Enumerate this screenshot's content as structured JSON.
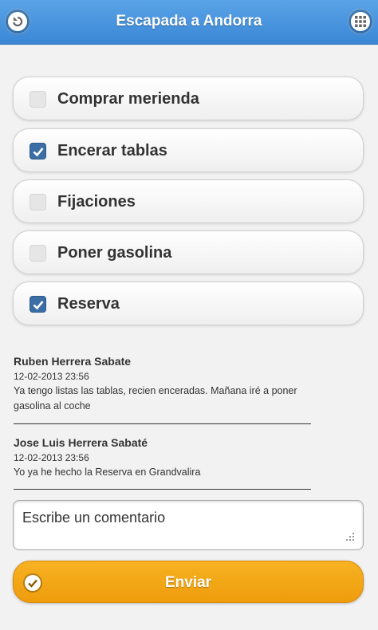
{
  "header": {
    "title": "Escapada a Andorra",
    "back_icon": "back-arrow-icon",
    "menu_icon": "grid-menu-icon",
    "accent_color": "#3a87d6"
  },
  "tasks": [
    {
      "label": "Comprar merienda",
      "checked": false
    },
    {
      "label": "Encerar tablas",
      "checked": true
    },
    {
      "label": "Fijaciones",
      "checked": false
    },
    {
      "label": "Poner gasolina",
      "checked": false
    },
    {
      "label": "Reserva",
      "checked": true
    }
  ],
  "comments": [
    {
      "author": "Ruben Herrera Sabate",
      "date": "12-02-2013 23:56",
      "text": "Ya tengo listas las tablas, recien enceradas. Mañana iré a poner gasolina al coche"
    },
    {
      "author": "Jose Luis Herrera Sabaté",
      "date": "12-02-2013 23:56",
      "text": "Yo ya he hecho la Reserva en Grandvalira"
    }
  ],
  "comment_form": {
    "placeholder": "Escribe un comentario",
    "value": "",
    "submit_label": "Enviar",
    "submit_icon": "check-circle-icon",
    "submit_color": "#f2a516"
  }
}
